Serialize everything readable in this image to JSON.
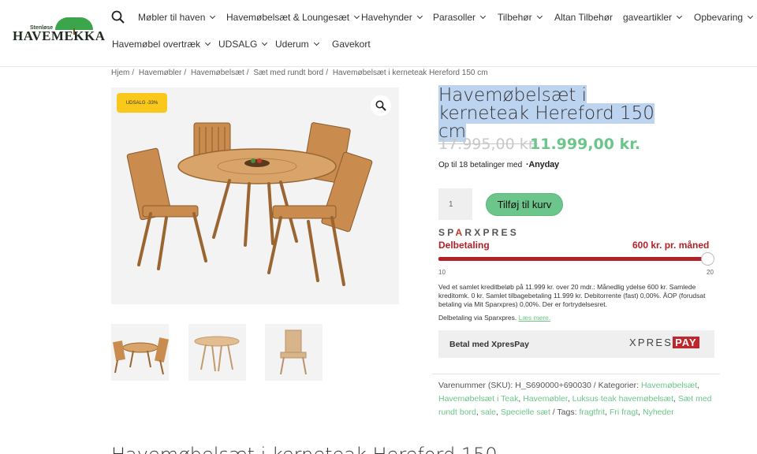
{
  "logo": {
    "small_text": "Stenløse",
    "big_text": "HAVEMEKKA"
  },
  "nav": {
    "row1": [
      "Møbler til haven",
      "Havemøbelsæt & Loungesæt",
      "Havehynder",
      "Parasoller",
      "Tilbehør",
      "Altan Tilbehør",
      "gaveartikler",
      "Opbevaring"
    ],
    "row2": [
      "Havemøbel overtræk",
      "UDSALG",
      "Uderum",
      "Gavekort"
    ]
  },
  "breadcrumb": [
    "Hjem",
    "Havemøbler",
    "Havemøbelsæt",
    "Sæt med rundt bord",
    "Havemøbelsæt i kerneteak Hereford 150 cm"
  ],
  "gallery": {
    "badge": "UDSALG -33%"
  },
  "product": {
    "title": "Havemøbelsæt i kerneteak Hereford 150 cm",
    "price_old": "17.995,00 kr.",
    "price_new": "11.999,00 kr.",
    "anyday_text": "Op til 18 betalinger med",
    "anyday_logo": "Anyday",
    "quantity": "1",
    "add_to_cart": "Tilføj til kurv"
  },
  "sparxpres": {
    "logo_pre": "SP",
    "logo_a": "A",
    "logo_post": "RXPRES",
    "label": "Delbetaling",
    "monthly": "600 kr. pr. måned",
    "slider_min": "10",
    "slider_max": "20",
    "slider_value": 20,
    "credit_text": "Ved et samlet kreditbeløb på 11.999 kr. over 20 mdr.: Månedlig ydelse 600 kr. Samlede kreditomk. 0 kr. Samlet tilbagebetaling 11.999 kr. Debitorrente (fast) 0,00%. ÅOP (forudsat betaling via Mit Sparxpres) 0,00%. Der er fortrydelsesret.",
    "via_text": "Delbetaling via Sparxpres.",
    "read_more": "Læs mere."
  },
  "xpres": {
    "label": "Betal med XpresPay",
    "logo_text": "XPRES",
    "logo_pay": "PAY"
  },
  "meta": {
    "sku_label": "Varenummer (SKU):",
    "sku": "H_S690000+690030",
    "categories_label": "Kategorier:",
    "categories": [
      "Havemøbelsæt",
      "Havemøbelsæt i Teak",
      "Havemøbler",
      "Luksus teak havemøbelsæt",
      "Sæt med rundt bord",
      "sale",
      "Specielle sæt"
    ],
    "tags_label": "Tags:",
    "tags": [
      "fragtfrit",
      "Fri fragt",
      "Nyheder"
    ]
  },
  "bottom_heading": "Havemøbelsæt i kerneteak Hereford 150",
  "colors": {
    "accent_green": "#6cc58a",
    "sparx_red": "#b32028",
    "badge_yellow": "#f9c81a"
  }
}
